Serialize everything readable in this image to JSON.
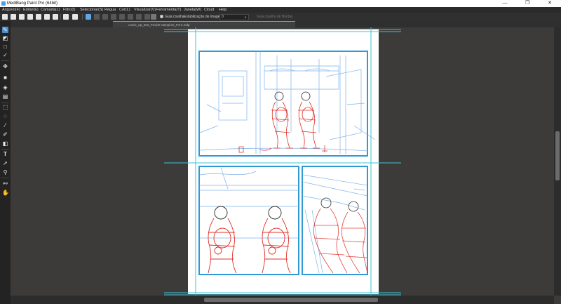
{
  "window": {
    "title": "MediBang Paint Pro (64bit)",
    "minimize": "—",
    "maximize": "❐",
    "close": "✕"
  },
  "menubar": {
    "items": [
      "Arquivo(F)",
      "Editar(E)",
      "Camada(L)",
      "Filtro(I)",
      "Selecionar(S)",
      "Régua",
      "Cor(L)",
      "Visualizar(V)",
      "Ferramenta(T)",
      "Janela(W)",
      "Cloud",
      "Help"
    ]
  },
  "commandbar": {
    "guide_label": "Guia:cisalha",
    "stabilization_label": "Estabilização de imagens",
    "stabilization_value": "0",
    "border_guide_label": "Guia:cisalha de Bordas"
  },
  "document": {
    "tab_title": "comic_ep_003_Pocket Vampiros_P3-2.mdp"
  },
  "colors": {
    "accent": "#5fa7e4",
    "panel_blue": "#2f9ad6",
    "sketch_blue": "#6aa6e6",
    "sketch_red": "#e0302a",
    "guide_cyan": "#3ec3d6"
  },
  "tools": [
    "pen-icon",
    "eraser-icon",
    "rect-icon",
    "check-icon",
    "move-icon",
    "fill-rect-icon",
    "bucket-icon",
    "gradient-icon",
    "select-rect-icon",
    "lasso-icon",
    "magic-wand-icon",
    "select-pen-icon",
    "select-eraser-icon",
    "text-icon",
    "operation-icon",
    "eyedropper-icon",
    "zoom-icon",
    "hand-icon"
  ]
}
